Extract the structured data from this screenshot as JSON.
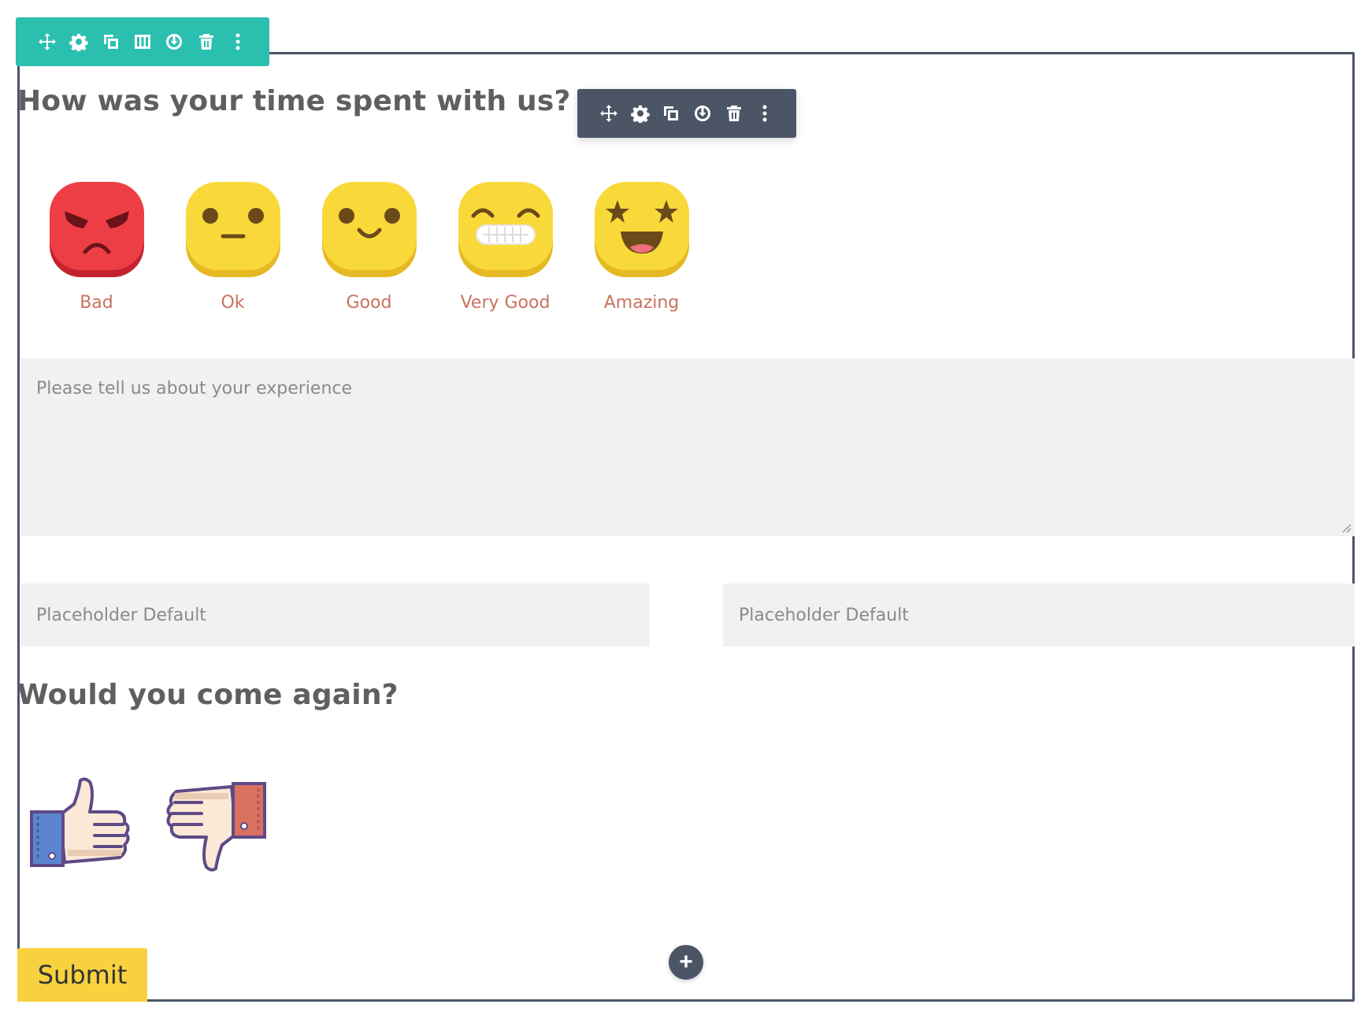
{
  "row_toolbar": {
    "icons": [
      "move-icon",
      "settings-icon",
      "duplicate-icon",
      "columns-icon",
      "save-icon",
      "delete-icon",
      "more-icon"
    ],
    "color": "#2bbfb0"
  },
  "module_toolbar": {
    "icons": [
      "move-icon",
      "settings-icon",
      "duplicate-icon",
      "save-icon",
      "delete-icon",
      "more-icon"
    ],
    "color": "#4c5566"
  },
  "form": {
    "question1": "How was your time spent with us?",
    "ratings": [
      {
        "label": "Bad",
        "color": "#ee3e45"
      },
      {
        "label": "Ok",
        "color": "#f9d939"
      },
      {
        "label": "Good",
        "color": "#f9d939"
      },
      {
        "label": "Very Good",
        "color": "#f9d939"
      },
      {
        "label": "Amazing",
        "color": "#f9d939"
      }
    ],
    "experience_placeholder": "Please tell us about your experience",
    "field_left_placeholder": "Placeholder Default",
    "field_right_placeholder": "Placeholder Default",
    "question2": "Would you come again?",
    "submit_label": "Submit",
    "add_label": "+"
  },
  "colors": {
    "frame": "#4a5568",
    "label": "#c9725f",
    "submit": "#f7d23e"
  }
}
